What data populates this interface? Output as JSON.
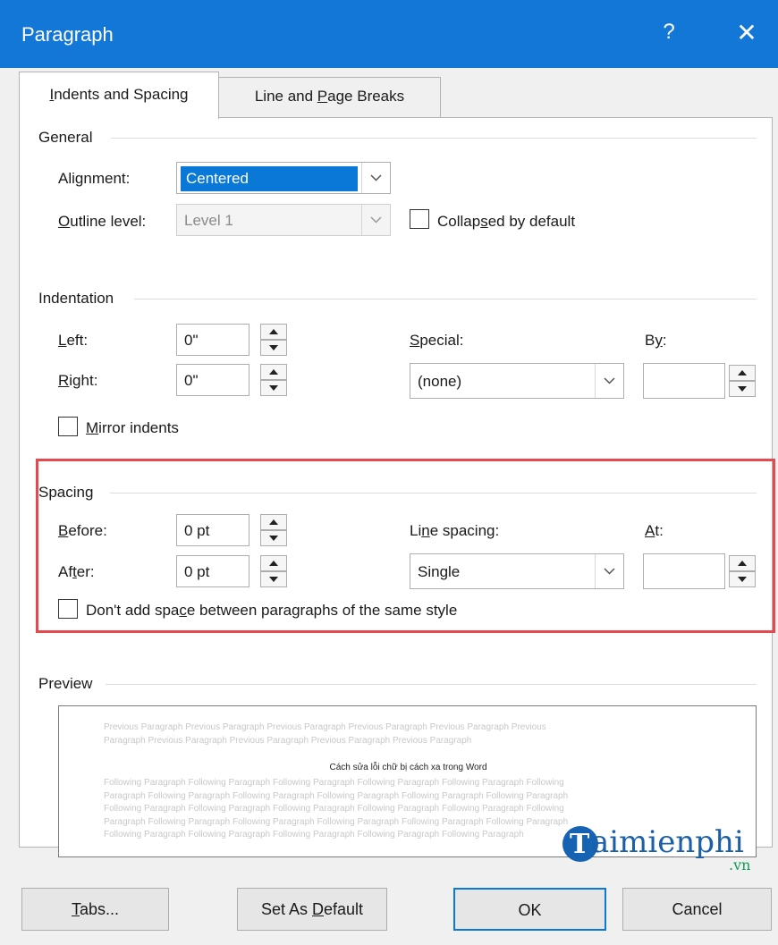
{
  "window": {
    "title": "Paragraph",
    "help": "?",
    "close": "✕"
  },
  "tabs": [
    {
      "pre": "",
      "ul": "I",
      "post": "ndents and Spacing"
    },
    {
      "pre": "Line and ",
      "ul": "P",
      "post": "age Breaks"
    }
  ],
  "general": {
    "heading": "General",
    "alignment": {
      "pre": "Ali",
      "ul": "g",
      "post": "nment:",
      "value": "Centered"
    },
    "outline": {
      "pre": "",
      "ul": "O",
      "post": "utline level:",
      "value": "Level 1"
    },
    "collapsed": {
      "pre": "Collap",
      "ul": "s",
      "post": "ed by default"
    }
  },
  "indentation": {
    "heading": "Indentation",
    "left": {
      "pre": "",
      "ul": "L",
      "post": "eft:",
      "value": "0\""
    },
    "right": {
      "pre": "",
      "ul": "R",
      "post": "ight:",
      "value": "0\""
    },
    "special": {
      "pre": "",
      "ul": "S",
      "post": "pecial:",
      "value": "(none)"
    },
    "by": {
      "pre": "B",
      "ul": "y",
      "post": ":",
      "value": ""
    },
    "mirror": {
      "pre": "",
      "ul": "M",
      "post": "irror indents"
    }
  },
  "spacing": {
    "heading": "Spacing",
    "before": {
      "pre": "",
      "ul": "B",
      "post": "efore:",
      "value": "0 pt"
    },
    "after": {
      "pre": "Af",
      "ul": "t",
      "post": "er:",
      "value": "0 pt"
    },
    "line_spacing": {
      "pre": "Li",
      "ul": "n",
      "post": "e spacing:",
      "value": "Single"
    },
    "at": {
      "pre": "",
      "ul": "A",
      "post": "t:",
      "value": ""
    },
    "dont_add": {
      "pre": "Don't add spa",
      "ul": "c",
      "post": "e between paragraphs of the same style"
    }
  },
  "preview": {
    "heading": "Preview",
    "previous_lines": [
      "Previous Paragraph Previous Paragraph Previous Paragraph Previous Paragraph Previous Paragraph Previous",
      "Paragraph Previous Paragraph Previous Paragraph Previous Paragraph Previous Paragraph"
    ],
    "sample": "Cách sửa lỗi chữ bị cách xa trong Word",
    "following_lines": [
      "Following Paragraph Following Paragraph Following Paragraph Following Paragraph Following Paragraph Following",
      "Paragraph Following Paragraph Following Paragraph Following Paragraph Following Paragraph Following Paragraph",
      "Following Paragraph Following Paragraph Following Paragraph Following Paragraph Following Paragraph Following",
      "Paragraph Following Paragraph Following Paragraph Following Paragraph Following Paragraph Following Paragraph",
      "Following Paragraph Following Paragraph Following Paragraph Following Paragraph Following Paragraph"
    ]
  },
  "watermark": {
    "logo_letter": "T",
    "brand": "aimienphi",
    "suffix": ".vn"
  },
  "buttons": {
    "tabs": {
      "pre": "",
      "ul": "T",
      "post": "abs..."
    },
    "set_default": {
      "pre": "Set As ",
      "ul": "D",
      "post": "efault"
    },
    "ok": "OK",
    "cancel": "Cancel"
  },
  "colors": {
    "titlebar": "#1277d6",
    "selection": "#0a78d7",
    "highlight_box": "#e34a4f",
    "watermark_blue": "#1a5fa8",
    "watermark_green": "#0f9e58"
  }
}
